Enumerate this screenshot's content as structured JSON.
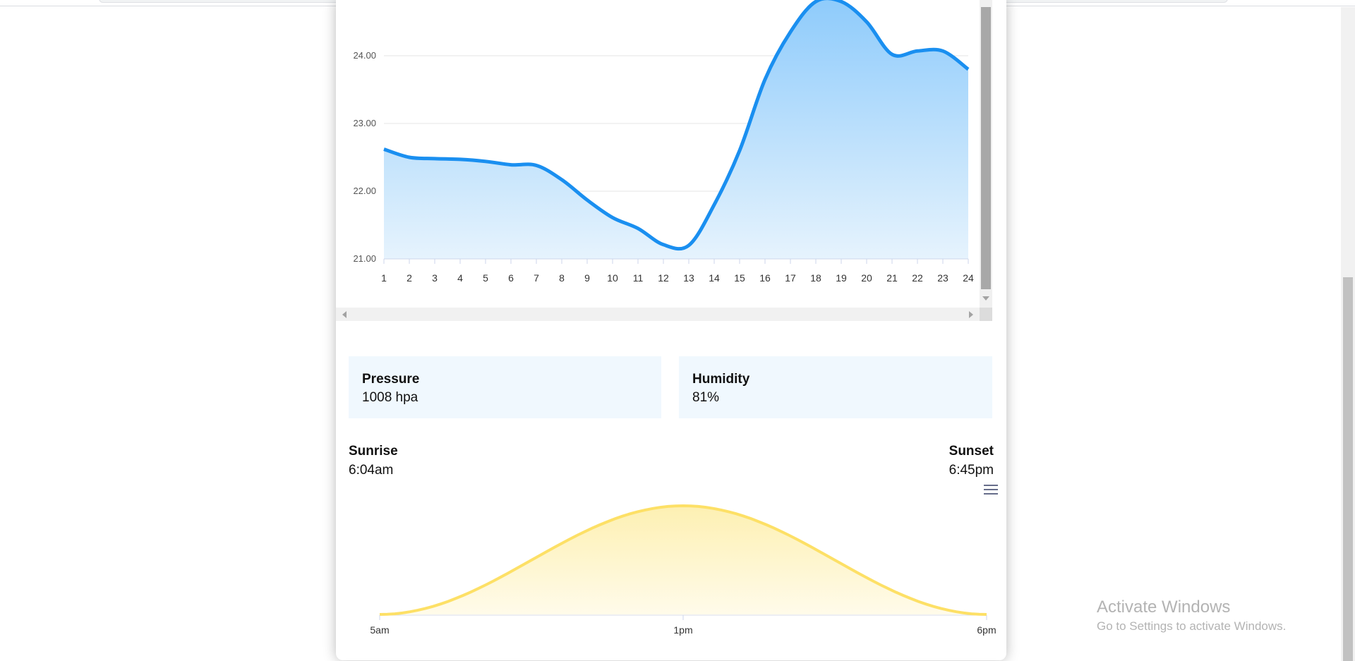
{
  "temperature_chart": {
    "y_ticks": [
      "21.00",
      "22.00",
      "23.00",
      "24.00"
    ],
    "x_ticks": [
      "1",
      "2",
      "3",
      "4",
      "5",
      "6",
      "7",
      "8",
      "9",
      "10",
      "11",
      "12",
      "13",
      "14",
      "15",
      "16",
      "17",
      "18",
      "19",
      "20",
      "21",
      "22",
      "23",
      "24"
    ],
    "line_color": "#1a8ff0",
    "fill_color_top": "#8ecbfb",
    "fill_color_bottom": "#e6f3fd"
  },
  "stats": {
    "pressure": {
      "label": "Pressure",
      "value": "1008 hpa"
    },
    "humidity": {
      "label": "Humidity",
      "value": "81%"
    }
  },
  "sun": {
    "sunrise": {
      "label": "Sunrise",
      "value": "6:04am"
    },
    "sunset": {
      "label": "Sunset",
      "value": "6:45pm"
    },
    "x_labels": [
      "5am",
      "1pm",
      "6pm"
    ],
    "line_color": "#fde066",
    "fill_color_top": "#fdf0b2",
    "fill_color_bottom": "#fffbea",
    "menu_icon": "hamburger-menu-icon"
  },
  "watermark": {
    "title": "Activate Windows",
    "subtitle": "Go to Settings to activate Windows."
  },
  "chart_data": [
    {
      "type": "area",
      "x": [
        1,
        2,
        3,
        4,
        5,
        6,
        7,
        8,
        9,
        10,
        11,
        12,
        13,
        14,
        15,
        16,
        17,
        18,
        19,
        20,
        21,
        22,
        23,
        24
      ],
      "y": [
        22.62,
        22.5,
        22.48,
        22.47,
        22.44,
        22.39,
        22.38,
        22.17,
        21.87,
        21.61,
        21.45,
        21.21,
        21.2,
        21.8,
        22.6,
        23.65,
        24.35,
        24.8,
        24.8,
        24.5,
        24.02,
        24.07,
        24.07,
        23.8
      ],
      "x_ticks": [
        "1",
        "2",
        "3",
        "4",
        "5",
        "6",
        "7",
        "8",
        "9",
        "10",
        "11",
        "12",
        "13",
        "14",
        "15",
        "16",
        "17",
        "18",
        "19",
        "20",
        "21",
        "22",
        "23",
        "24"
      ],
      "y_ticks": [
        "21.00",
        "22.00",
        "23.00",
        "24.00"
      ],
      "ylim": [
        21,
        24.75
      ],
      "grid": true
    },
    {
      "type": "area",
      "x_labels": [
        "5am",
        "1pm",
        "6pm"
      ],
      "x": [
        0,
        0.5,
        1
      ],
      "y": [
        0,
        1,
        0
      ],
      "ylim": [
        0,
        1
      ]
    }
  ]
}
